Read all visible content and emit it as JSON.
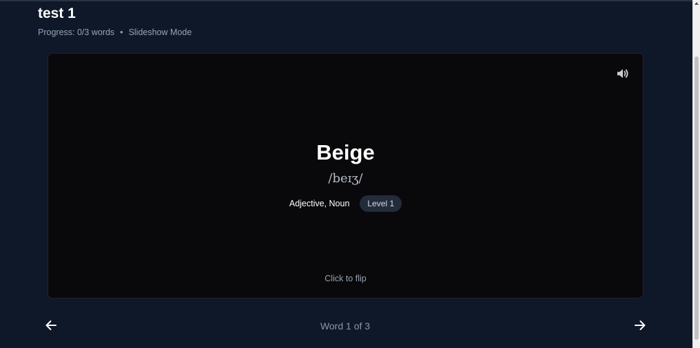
{
  "header": {
    "title": "test 1",
    "progress": "Progress: 0/3 words",
    "separator": "•",
    "mode": "Slideshow Mode"
  },
  "card": {
    "word": "Beige",
    "phonetic": "/beɪʒ/",
    "part_of_speech": "Adjective, Noun",
    "level_badge": "Level 1",
    "hint": "Click to flip",
    "speaker_icon": "speaker-volume-icon"
  },
  "footer": {
    "counter": "Word 1 of 3",
    "prev_icon": "arrow-left-icon",
    "next_icon": "arrow-right-icon"
  },
  "colors": {
    "background": "#0f1828",
    "card": "#09090b",
    "badge": "#232c3b",
    "text_primary": "#ffffff",
    "text_muted": "#9aa3b2"
  }
}
